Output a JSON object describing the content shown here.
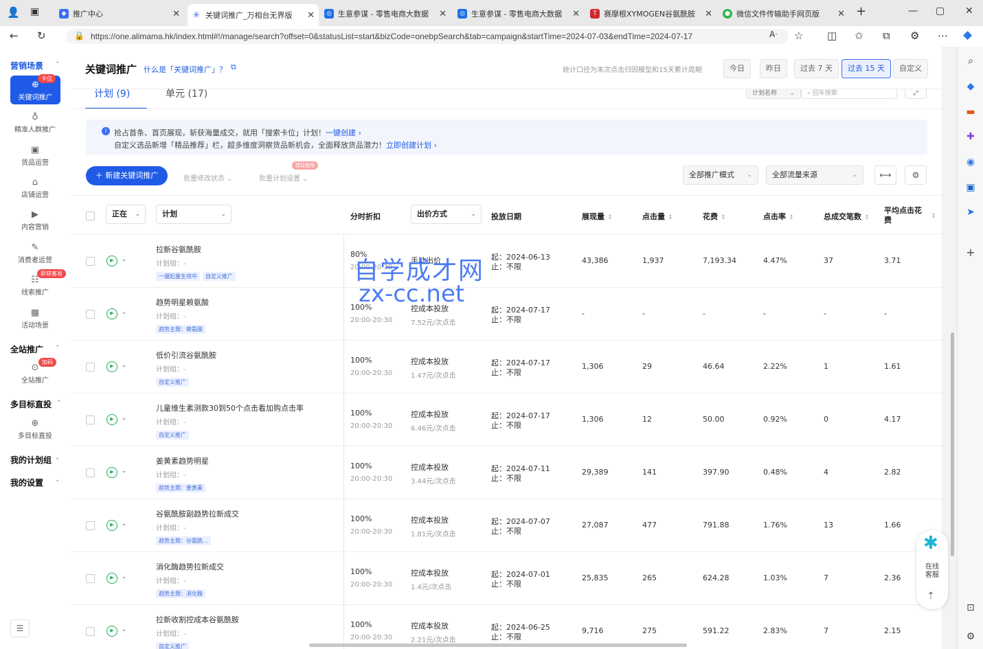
{
  "browser": {
    "tabs": [
      {
        "title": "推广中心",
        "favicon_color": "#3b6ef2",
        "icon": "shield-icon"
      },
      {
        "title": "关键词推广_万相台无界版",
        "favicon_color": "#3b6ef2",
        "icon": "sparkle-icon"
      },
      {
        "title": "生意参谋 - 零售电商大数据",
        "favicon_color": "#1f6fe6",
        "icon": "chart-icon"
      },
      {
        "title": "生意参谋 - 零售电商大数据",
        "favicon_color": "#1f6fe6",
        "icon": "chart-icon"
      },
      {
        "title": "赛摩根XYMOGEN谷氨酰胺",
        "favicon_color": "#d0282e",
        "icon": "t-icon"
      },
      {
        "title": "微信文件传输助手网页版",
        "favicon_color": "#35b34a",
        "icon": "wechat-icon"
      }
    ],
    "url": "https://one.alimama.hk/index.html#!/manage/search?offset=0&statusList=start&bizCode=onebpSearch&tab=campaign&startTime=2024-07-03&endTime=2024-07-17"
  },
  "sidebar": {
    "sections": [
      {
        "title": "营销场景"
      },
      {
        "title": "全站推广"
      },
      {
        "title": "多目标直投"
      },
      {
        "title": "我的计划组"
      },
      {
        "title": "我的设置"
      }
    ],
    "items": [
      {
        "label": "关键词推广",
        "badge": "卡位"
      },
      {
        "label": "精准人群推广"
      },
      {
        "label": "货品运营"
      },
      {
        "label": "店铺运营"
      },
      {
        "label": "内容营销"
      },
      {
        "label": "消费者运营"
      },
      {
        "label": "线索推广",
        "badge": "即获客易"
      },
      {
        "label": "活动场景"
      },
      {
        "label": "全站推广",
        "badge": "加码"
      },
      {
        "label": "多目标直投"
      }
    ]
  },
  "header": {
    "title": "关键词推广",
    "help_link": "什么是「关键词推广」？",
    "stat_note": "统计口径为末次点击归因模型和15天累计周期",
    "date_buttons": [
      "今日",
      "昨日",
      "过去 7 天",
      "过去 15 天",
      "自定义"
    ],
    "active_date": "过去 15 天"
  },
  "tabs": [
    "计划 (9)",
    "单元 (17)"
  ],
  "search": {
    "field": "计划名称",
    "placeholder": "回车搜索"
  },
  "notice": {
    "line1": "抢占首条、首页展现，斩获海量成交，就用「搜索卡位」计划！",
    "line1_link": "一键创建",
    "line2": "自定义选品新增「精品推荐」栏，超多维度洞察货品新机会，全面释放货品潜力！",
    "line2_link": "立即创建计划"
  },
  "toolbar": {
    "new_button": "新建关键词推广",
    "batch_status": "批量修改状态",
    "batch_settings": "批量计划设置",
    "batch_badge": "建议使用",
    "mode_select": "全部推广模式",
    "source_select": "全部流量来源"
  },
  "table": {
    "status_select": "正在",
    "plan_select": "计划",
    "columns": [
      "分时折扣",
      "出价方式",
      "投放日期",
      "展现量",
      "点击量",
      "花费",
      "点击率",
      "总成交笔数",
      "平均点击花费"
    ],
    "rows": [
      {
        "name": "拉新谷氨酰胺",
        "group": "计划组：-",
        "tags": [
          "一键起量生效中",
          "自定义推广"
        ],
        "discount": "80%",
        "time": "20:00-20:30",
        "bid": "手动出价",
        "bid_sub": "",
        "start": "起：2024-06-13",
        "end": "止：不限",
        "impressions": "43,386",
        "clicks": "1,937",
        "cost": "7,193.34",
        "ctr": "4.47%",
        "orders": "37",
        "cpc": "3.71"
      },
      {
        "name": "趋势明星赖氨酸",
        "group": "计划组：-",
        "tags": [
          "趋势主题：赖氨酸"
        ],
        "discount": "100%",
        "time": "20:00-20:30",
        "bid": "控成本投放",
        "bid_sub": "7.52元/次点击",
        "start": "起：2024-07-17",
        "end": "止：不限",
        "impressions": "-",
        "clicks": "-",
        "cost": "-",
        "ctr": "-",
        "orders": "-",
        "cpc": "-"
      },
      {
        "name": "低价引流谷氨酰胺",
        "group": "计划组：-",
        "tags": [
          "自定义推广"
        ],
        "discount": "100%",
        "time": "20:00-20:30",
        "bid": "控成本投放",
        "bid_sub": "1.47元/次点击",
        "start": "起：2024-07-17",
        "end": "止：不限",
        "impressions": "1,306",
        "clicks": "29",
        "cost": "46.64",
        "ctr": "2.22%",
        "orders": "1",
        "cpc": "1.61"
      },
      {
        "name": "儿童维生素测款30到50个点击看加购点击率",
        "group": "计划组：-",
        "tags": [
          "自定义推广"
        ],
        "discount": "100%",
        "time": "20:00-20:30",
        "bid": "控成本投放",
        "bid_sub": "6.46元/次点击",
        "start": "起：2024-07-17",
        "end": "止：不限",
        "impressions": "1,306",
        "clicks": "12",
        "cost": "50.00",
        "ctr": "0.92%",
        "orders": "0",
        "cpc": "4.17"
      },
      {
        "name": "姜黄素趋势明星",
        "group": "计划组：-",
        "tags": [
          "趋势主题：姜黄素"
        ],
        "discount": "100%",
        "time": "20:00-20:30",
        "bid": "控成本投放",
        "bid_sub": "3.44元/次点击",
        "start": "起：2024-07-11",
        "end": "止：不限",
        "impressions": "29,389",
        "clicks": "141",
        "cost": "397.90",
        "ctr": "0.48%",
        "orders": "4",
        "cpc": "2.82"
      },
      {
        "name": "谷氨酰胺副趋势拉新成交",
        "group": "计划组：-",
        "tags": [
          "趋势主题：谷氨酰..."
        ],
        "discount": "100%",
        "time": "20:00-20:30",
        "bid": "控成本投放",
        "bid_sub": "1.81元/次点击",
        "start": "起：2024-07-07",
        "end": "止：不限",
        "impressions": "27,087",
        "clicks": "477",
        "cost": "791.88",
        "ctr": "1.76%",
        "orders": "13",
        "cpc": "1.66"
      },
      {
        "name": "消化酶趋势拉新成交",
        "group": "计划组：-",
        "tags": [
          "趋势主题：消化酶"
        ],
        "discount": "100%",
        "time": "20:00-20:30",
        "bid": "控成本投放",
        "bid_sub": "1.4元/次点击",
        "start": "起：2024-07-01",
        "end": "止：不限",
        "impressions": "25,835",
        "clicks": "265",
        "cost": "624.28",
        "ctr": "1.03%",
        "orders": "7",
        "cpc": "2.36"
      },
      {
        "name": "拉新收割控成本谷氨酰胺",
        "group": "计划组：-",
        "tags": [
          "自定义推广"
        ],
        "discount": "100%",
        "time": "20:00-20:30",
        "bid": "控成本投放",
        "bid_sub": "2.21元/次点击",
        "start": "起：2024-06-25",
        "end": "止：不限",
        "impressions": "9,716",
        "clicks": "275",
        "cost": "591.22",
        "ctr": "2.83%",
        "orders": "7",
        "cpc": "2.15"
      }
    ]
  },
  "watermark": {
    "line1": "自学成才网",
    "line2": "zx-cc.net"
  },
  "service": {
    "label": "在线客服"
  }
}
